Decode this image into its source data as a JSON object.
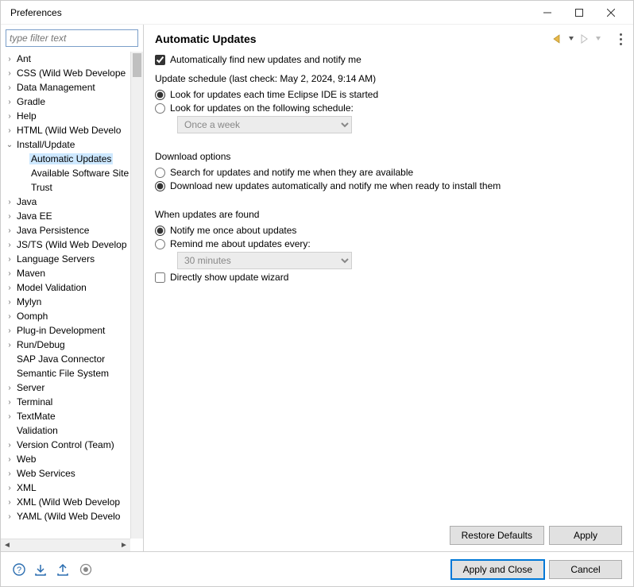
{
  "window": {
    "title": "Preferences"
  },
  "sidebar": {
    "filter_placeholder": "type filter text",
    "items": [
      {
        "label": "Ant",
        "hasChildren": true
      },
      {
        "label": "CSS (Wild Web Develope",
        "hasChildren": true
      },
      {
        "label": "Data Management",
        "hasChildren": true
      },
      {
        "label": "Gradle",
        "hasChildren": true
      },
      {
        "label": "Help",
        "hasChildren": true
      },
      {
        "label": "HTML (Wild Web Develo",
        "hasChildren": true
      },
      {
        "label": "Install/Update",
        "hasChildren": true,
        "expanded": true,
        "children": [
          {
            "label": "Automatic Updates",
            "selected": true
          },
          {
            "label": "Available Software Site"
          },
          {
            "label": "Trust"
          }
        ]
      },
      {
        "label": "Java",
        "hasChildren": true
      },
      {
        "label": "Java EE",
        "hasChildren": true
      },
      {
        "label": "Java Persistence",
        "hasChildren": true
      },
      {
        "label": "JS/TS (Wild Web Develop",
        "hasChildren": true
      },
      {
        "label": "Language Servers",
        "hasChildren": true
      },
      {
        "label": "Maven",
        "hasChildren": true
      },
      {
        "label": "Model Validation",
        "hasChildren": true
      },
      {
        "label": "Mylyn",
        "hasChildren": true
      },
      {
        "label": "Oomph",
        "hasChildren": true
      },
      {
        "label": "Plug-in Development",
        "hasChildren": true
      },
      {
        "label": "Run/Debug",
        "hasChildren": true
      },
      {
        "label": "SAP Java Connector",
        "hasChildren": false
      },
      {
        "label": "Semantic File System",
        "hasChildren": false
      },
      {
        "label": "Server",
        "hasChildren": true
      },
      {
        "label": "Terminal",
        "hasChildren": true
      },
      {
        "label": "TextMate",
        "hasChildren": true
      },
      {
        "label": "Validation",
        "hasChildren": false
      },
      {
        "label": "Version Control (Team)",
        "hasChildren": true
      },
      {
        "label": "Web",
        "hasChildren": true
      },
      {
        "label": "Web Services",
        "hasChildren": true
      },
      {
        "label": "XML",
        "hasChildren": true
      },
      {
        "label": "XML (Wild Web Develop",
        "hasChildren": true
      },
      {
        "label": "YAML (Wild Web Develo",
        "hasChildren": true
      }
    ]
  },
  "page": {
    "title": "Automatic Updates",
    "auto_find_label": "Automatically find new updates and notify me",
    "schedule_header": "Update schedule (last check: May 2, 2024, 9:14 AM)",
    "schedule_radio1": "Look for updates each time Eclipse IDE is started",
    "schedule_radio2": "Look for updates on the following schedule:",
    "schedule_select": "Once a week",
    "download_header": "Download options",
    "download_radio1": "Search for updates and notify me when they are available",
    "download_radio2": "Download new updates automatically and notify me when ready to install them",
    "found_header": "When updates are found",
    "found_radio1": "Notify me once about updates",
    "found_radio2": "Remind me about updates every:",
    "found_select": "30 minutes",
    "direct_wizard": "Directly show update wizard"
  },
  "buttons": {
    "restore_defaults": "Restore Defaults",
    "apply": "Apply",
    "apply_close": "Apply and Close",
    "cancel": "Cancel"
  }
}
